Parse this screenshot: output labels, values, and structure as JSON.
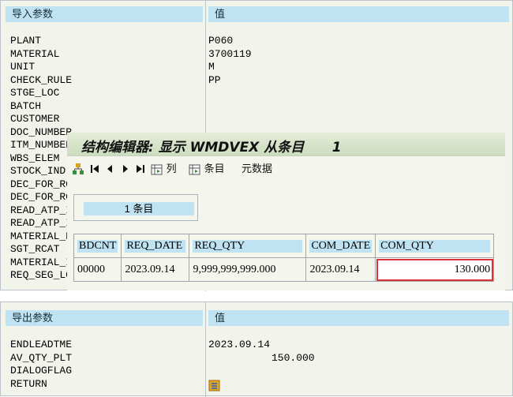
{
  "import_params": {
    "header_param": "导入参数",
    "header_value": "值",
    "rows": [
      {
        "name": "PLANT",
        "value": "P060"
      },
      {
        "name": "MATERIAL",
        "value": "3700119"
      },
      {
        "name": "UNIT",
        "value": "M"
      },
      {
        "name": "CHECK_RULE",
        "value": "PP"
      },
      {
        "name": "STGE_LOC",
        "value": ""
      },
      {
        "name": "BATCH",
        "value": ""
      },
      {
        "name": "CUSTOMER",
        "value": ""
      },
      {
        "name": "DOC_NUMBER",
        "value": ""
      },
      {
        "name": "ITM_NUMBER",
        "value": ""
      },
      {
        "name": "WBS_ELEM",
        "value": ""
      },
      {
        "name": "STOCK_IND",
        "value": ""
      },
      {
        "name": "DEC_FOR_RO",
        "value": ""
      },
      {
        "name": "DEC_FOR_RO",
        "value": ""
      },
      {
        "name": "READ_ATP_I",
        "value": ""
      },
      {
        "name": "READ_ATP_I",
        "value": ""
      },
      {
        "name": "MATERIAL_E",
        "value": ""
      },
      {
        "name": "SGT_RCAT",
        "value": ""
      },
      {
        "name": "MATERIAL_I",
        "value": ""
      },
      {
        "name": "REQ_SEG_LO",
        "value": ""
      }
    ]
  },
  "dialog": {
    "title": "结构编辑器: 显示 WMDVEX 从条目      1",
    "toolbar": {
      "columns_label": "列",
      "entries_label": "条目",
      "metadata_label": "元数据"
    },
    "entry_count": "1 条目",
    "table": {
      "headers": [
        "BDCNT",
        "REQ_DATE",
        "REQ_QTY",
        "COM_DATE",
        "COM_QTY"
      ],
      "rows": [
        [
          "00000",
          "2023.09.14",
          "9,999,999,999.000",
          "2023.09.14",
          "130.000"
        ]
      ]
    }
  },
  "export_params": {
    "header_param": "导出参数",
    "header_value": "值",
    "rows": [
      {
        "name": "ENDLEADTME",
        "value": "2023.09.14"
      },
      {
        "name": "AV_QTY_PLT",
        "value": "150.000"
      },
      {
        "name": "DIALOGFLAG",
        "value": ""
      },
      {
        "name": "RETURN",
        "value": ""
      }
    ]
  },
  "colors": {
    "header_blue": "#bfe3f2",
    "panel_bg": "#f2f4ec",
    "selected_border": "#d8323c"
  }
}
